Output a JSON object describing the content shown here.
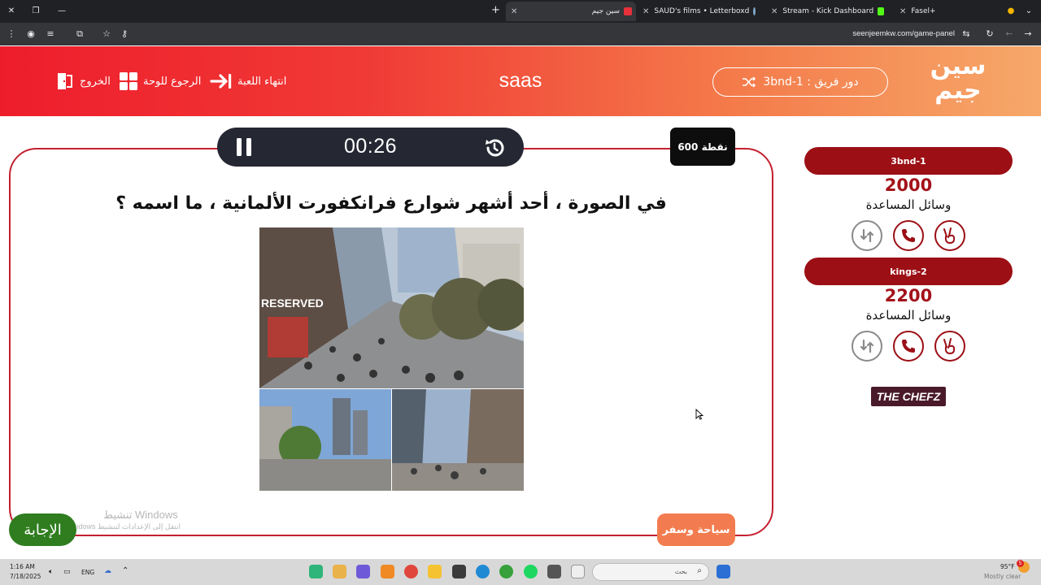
{
  "browser": {
    "tabs": [
      {
        "title": "سين جيم",
        "active": true,
        "favicon_color": "#e8303a"
      },
      {
        "title": "SAUD's films • Letterboxd",
        "active": false,
        "favicon_color": "#7da7c7"
      },
      {
        "title": "Stream - Kick Dashboard",
        "active": false,
        "favicon_color": "#53fc18"
      },
      {
        "title": "Fasel+",
        "active": false,
        "favicon_color": "#f7b500"
      }
    ],
    "url": "seenjeemkw.com/game-panel"
  },
  "header": {
    "logo_line1": "سين",
    "logo_line2": "جيم",
    "turn_label": "دور فريق : 3bnd-1",
    "game_name": "saas",
    "end_game": "انتهاء اللعبة",
    "back_to_board": "الرجوع للوحة",
    "exit": "الخروج"
  },
  "question": {
    "timer": "00:26",
    "points": "600 نقطة",
    "text": "في الصورة ، أحد أشهر شوارع فرانكفورت الألمانية ، ما اسمه ؟",
    "category": "سياحة وسفر",
    "answer_button": "الإجابة",
    "photo_sign": "RESERVED"
  },
  "teams": [
    {
      "name": "3bnd-1",
      "score": "2000",
      "helpers_label": "وسائل المساعدة"
    },
    {
      "name": "kings-2",
      "score": "2200",
      "helpers_label": "وسائل المساعدة"
    }
  ],
  "sponsor": "THE CHEFZ",
  "watermark": {
    "title": "تنشيط Windows",
    "subtitle": "انتقل إلى الإعدادات لتنشيط Windows"
  },
  "taskbar": {
    "time": "1:16 AM",
    "date": "7/18/2025",
    "lang": "ENG",
    "search_placeholder": "بحث",
    "weather_temp": "95°F",
    "weather_text": "Mostly clear",
    "notification_count": "5"
  },
  "colors": {
    "brand_red": "#ee1d2c",
    "team_red": "#9b0f15",
    "category_orange": "#f27c4f",
    "answer_green": "#2f7d1f",
    "timer_bg": "#252733"
  }
}
